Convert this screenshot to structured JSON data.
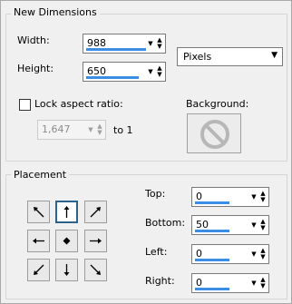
{
  "new_dimensions": {
    "title": "New Dimensions",
    "width_label": "Width:",
    "width_value": "988",
    "height_label": "Height:",
    "height_value": "650",
    "units_value": "Pixels",
    "lock_label": "Lock aspect ratio:",
    "lock_checked": false,
    "ratio_value": "1,647",
    "ratio_suffix": "to 1",
    "background_label": "Background:",
    "background_icon": "no-entry-icon"
  },
  "placement": {
    "title": "Placement",
    "selected": "top-center",
    "anchors": [
      {
        "name": "anchor-top-left",
        "icon": "arrow-up-left-icon"
      },
      {
        "name": "anchor-top-center",
        "icon": "arrow-up-icon"
      },
      {
        "name": "anchor-top-right",
        "icon": "arrow-up-right-icon"
      },
      {
        "name": "anchor-middle-left",
        "icon": "arrow-left-icon"
      },
      {
        "name": "anchor-center",
        "icon": "diamond-icon"
      },
      {
        "name": "anchor-middle-right",
        "icon": "arrow-right-icon"
      },
      {
        "name": "anchor-bottom-left",
        "icon": "arrow-down-left-icon"
      },
      {
        "name": "anchor-bottom-center",
        "icon": "arrow-down-icon"
      },
      {
        "name": "anchor-bottom-right",
        "icon": "arrow-down-right-icon"
      }
    ],
    "top_label": "Top:",
    "top_value": "0",
    "bottom_label": "Bottom:",
    "bottom_value": "50",
    "left_label": "Left:",
    "left_value": "0",
    "right_label": "Right:",
    "right_value": "0"
  },
  "colors": {
    "accent": "#3a8ee6",
    "selected_border": "#2c628b"
  }
}
